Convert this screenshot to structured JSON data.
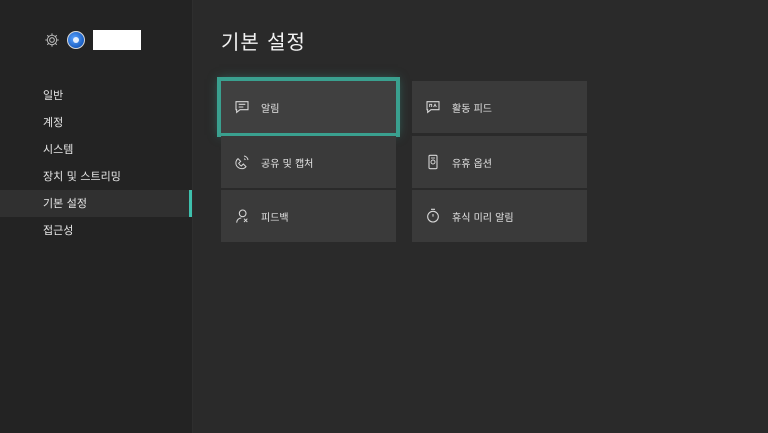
{
  "sidebar": {
    "items": [
      {
        "label": "일반"
      },
      {
        "label": "계정"
      },
      {
        "label": "시스템"
      },
      {
        "label": "장치 및 스트리밍"
      },
      {
        "label": "기본 설정"
      },
      {
        "label": "접근성"
      }
    ],
    "active_index": 4,
    "icons": [
      "gear-icon",
      "avatar-icon"
    ]
  },
  "main": {
    "title": "기본 설정",
    "tiles": [
      {
        "label": "알림",
        "icon": "notification-icon"
      },
      {
        "label": "활동 피드",
        "icon": "activity-feed-icon"
      },
      {
        "label": "공유 및 캡처",
        "icon": "capture-icon"
      },
      {
        "label": "유휴 옵션",
        "icon": "idle-options-icon"
      },
      {
        "label": "피드백",
        "icon": "feedback-icon"
      },
      {
        "label": "휴식 미리 알림",
        "icon": "timer-icon"
      }
    ],
    "focused_index": 0
  },
  "colors": {
    "accent": "#3ec0ad",
    "focus_ring": "#3aa08f",
    "sidebar_bg": "#232323",
    "main_bg": "#2a2a2a",
    "tile_bg": "#3a3a3a"
  }
}
